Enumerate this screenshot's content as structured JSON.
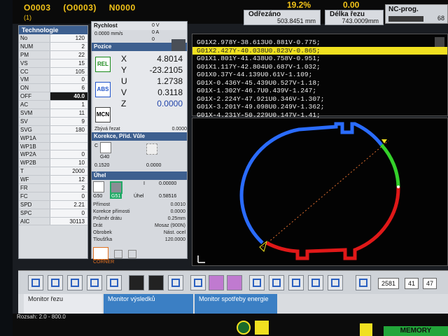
{
  "header": {
    "program": "O0003",
    "program_paren": "(O0003)",
    "sequence": "N0000",
    "sub": "(1)",
    "percent": "19.2%",
    "rate": "0.00",
    "odrezano_label": "Odřezáno",
    "odrezano_value": "503.8451",
    "odrezano_unit": "mm",
    "delka_label": "Délka řezu",
    "delka_value": "743.0009",
    "delka_unit": "mm",
    "nc_label": "NC-prog.",
    "nc_value": "68"
  },
  "tech": {
    "title": "Technologie",
    "rows": [
      {
        "k": "No",
        "v": "120"
      },
      {
        "k": "NUM",
        "v": "2"
      },
      {
        "k": "PM",
        "v": "22"
      },
      {
        "k": "VS",
        "v": "15"
      },
      {
        "k": "CC",
        "v": "105"
      },
      {
        "k": "VM",
        "v": "0"
      },
      {
        "k": "ON",
        "v": "6"
      },
      {
        "k": "OFF",
        "v": "40.0"
      },
      {
        "k": "AC",
        "v": "1"
      },
      {
        "k": "SVM",
        "v": "11"
      },
      {
        "k": "SV",
        "v": "9"
      },
      {
        "k": "SVG",
        "v": "180"
      },
      {
        "k": "WP1A",
        "v": ""
      },
      {
        "k": "WP1B",
        "v": ""
      },
      {
        "k": "WP2A",
        "v": "0"
      },
      {
        "k": "WP2B",
        "v": "10"
      },
      {
        "k": "T",
        "v": "2000"
      },
      {
        "k": "WF",
        "v": "12"
      },
      {
        "k": "FR",
        "v": "2"
      },
      {
        "k": "FC",
        "v": "0"
      },
      {
        "k": "SPD",
        "v": "2.21"
      },
      {
        "k": "SPC",
        "v": "0"
      },
      {
        "k": "AIC",
        "v": "30113"
      }
    ]
  },
  "rychlost": {
    "title": "Rychlost",
    "value": "0.0000",
    "unit": "mm/s",
    "v_label": "0 V",
    "a_label": "0 A",
    "v2": "0"
  },
  "pozice": {
    "title": "Pozice",
    "rel": "REL",
    "abs": "ABS",
    "mcn": "MCN",
    "axes": [
      "X",
      "Y",
      "U",
      "V",
      "Z"
    ],
    "values": [
      "4.8014",
      "-23.2105",
      "1.2738",
      "0.3118",
      "0.0000"
    ],
    "remaining_label": "Zbývá řezat",
    "remaining_value": "0.0000"
  },
  "korekce": {
    "title": "Korekce, Přid. Vůle",
    "c_label": "C",
    "code": "G40",
    "v1": "0.1520",
    "v2": "0.0000"
  },
  "uhel": {
    "title": "Úhel",
    "g50": "G50",
    "g51": "G51",
    "i_label": "I",
    "i_value": "0.00000",
    "uhel_label": "Úhel",
    "uhel_value": "0.58516"
  },
  "params": [
    {
      "k": "Přímost",
      "v": "0.0010"
    },
    {
      "k": "Korekce přímosti",
      "v": "0.0000"
    },
    {
      "k": "Průměr drátu",
      "v": "0.25mm"
    },
    {
      "k": "Drát",
      "v": "Mosaz (900N)"
    },
    {
      "k": "Obrobek",
      "v": "Nást. ocel"
    },
    {
      "k": "Tloušťka",
      "v": "120.0000"
    }
  ],
  "corner_label": "CORNER",
  "gcode": {
    "lines": [
      "G01X2.978Y-38.613U0.881V-0.775;",
      "G01X2.427Y-40.038U0.823V-0.865;",
      "G01X1.801Y-41.438U0.758V-0.951;",
      "G01X1.117Y-42.804U0.687V-1.032;",
      "G01X0.37Y-44.139U0.61V-1.109;",
      "G01X-0.436Y-45.439U0.527V-1.18;",
      "G01X-1.302Y-46.7U0.439V-1.247;",
      "G01X-2.224Y-47.921U0.346V-1.307;",
      "G01X-3.201Y-49.098U0.249V-1.362;",
      "G01X-4.231Y-50.229U0.147V-1.41;"
    ],
    "active_index": 1
  },
  "toolbar": {
    "coord_a": "2581",
    "coord_b": "41",
    "coord_c": "47"
  },
  "tabs": [
    {
      "label": "Monitor řezu"
    },
    {
      "label": "Monitor výsledků"
    },
    {
      "label": "Monitor spotřeby energie"
    }
  ],
  "status": {
    "rozsah": "Rozsah: 2.0 - 800.0",
    "memory": "MEMORY"
  },
  "colors": {
    "accent": "#3d5f8f",
    "highlight": "#f0e020",
    "path_blue": "#2a6cff",
    "path_green": "#34d12a",
    "path_red": "#e01818"
  }
}
